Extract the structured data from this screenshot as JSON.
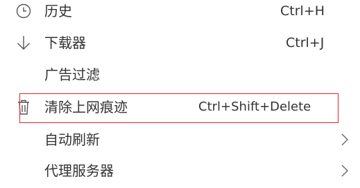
{
  "menu": {
    "items": [
      {
        "icon": "clock-icon",
        "label": "历史",
        "shortcut": "Ctrl+H"
      },
      {
        "icon": "download-arrow-icon",
        "label": "下载器",
        "shortcut": "Ctrl+J"
      },
      {
        "icon": "",
        "label": "广告过滤",
        "shortcut": ""
      },
      {
        "icon": "trash-icon",
        "label": "清除上网痕迹",
        "shortcut": "Ctrl+Shift+Delete",
        "highlighted": true
      },
      {
        "icon": "",
        "label": "自动刷新",
        "shortcut": "",
        "submenu": true
      },
      {
        "icon": "",
        "label": "代理服务器",
        "shortcut": "",
        "submenu": true
      }
    ]
  },
  "highlight_color": "#d9262c"
}
